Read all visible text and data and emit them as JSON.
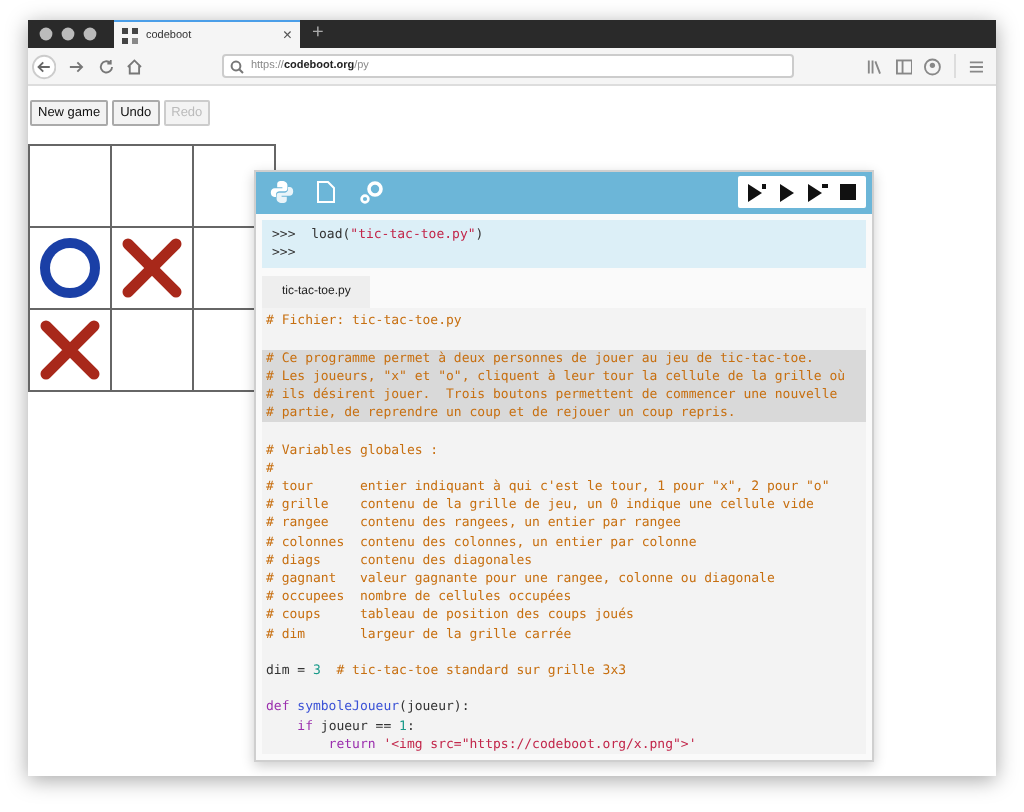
{
  "browser": {
    "tab_title": "codeboot",
    "tab_close": "×",
    "new_tab": "+",
    "url": "https://**codeboot.org**/py"
  },
  "page_buttons": [
    {
      "label": "New game",
      "disabled": false
    },
    {
      "label": "Undo",
      "disabled": false
    },
    {
      "label": "Redo",
      "disabled": true
    }
  ],
  "board": [
    [
      {
        "kind": "empty"
      },
      {
        "kind": "empty"
      },
      {
        "kind": "empty"
      }
    ],
    [
      {
        "kind": "o"
      },
      {
        "kind": "x"
      },
      {
        "kind": "empty"
      }
    ],
    [
      {
        "kind": "x"
      },
      {
        "kind": "empty"
      },
      {
        "kind": "empty"
      }
    ]
  ],
  "repl": [
    [
      {
        "kind": "prompt",
        "text": ">>>"
      },
      {
        "kind": "plain",
        "text": "  load("
      },
      {
        "kind": "string",
        "text": "\"tic-tac-toe.py\""
      },
      {
        "kind": "plain",
        "text": ")"
      }
    ],
    [
      {
        "kind": "prompt",
        "text": ">>>"
      }
    ]
  ],
  "editor_tab": {
    "label": "tic-tac-toe.py",
    "selected": true
  },
  "code": [
    {
      "kind": "code",
      "highlighted": false,
      "segments": [
        {
          "kind": "comment",
          "text": "# Fichier: tic-tac-toe.py"
        }
      ]
    },
    {
      "kind": "blank",
      "highlighted": false
    },
    {
      "kind": "code",
      "highlighted": true,
      "segments": [
        {
          "kind": "comment",
          "text": "# Ce programme permet à deux personnes de jouer au jeu de tic-tac-toe."
        }
      ]
    },
    {
      "kind": "code",
      "highlighted": true,
      "segments": [
        {
          "kind": "comment",
          "text": "# Les joueurs, \"x\" et \"o\", cliquent à leur tour la cellule de la grille où"
        }
      ]
    },
    {
      "kind": "code",
      "highlighted": true,
      "segments": [
        {
          "kind": "comment",
          "text": "# ils désirent jouer.  Trois boutons permettent de commencer une nouvelle"
        }
      ]
    },
    {
      "kind": "code",
      "highlighted": true,
      "segments": [
        {
          "kind": "comment",
          "text": "# partie, de reprendre un coup et de rejouer un coup repris."
        }
      ]
    },
    {
      "kind": "blank",
      "highlighted": false
    },
    {
      "kind": "code",
      "highlighted": false,
      "segments": [
        {
          "kind": "comment",
          "text": "# Variables globales :"
        }
      ]
    },
    {
      "kind": "code",
      "highlighted": false,
      "segments": [
        {
          "kind": "comment",
          "text": "#"
        }
      ]
    },
    {
      "kind": "code",
      "highlighted": false,
      "segments": [
        {
          "kind": "comment",
          "text": "# tour      entier indiquant à qui c'est le tour, 1 pour \"x\", 2 pour \"o\""
        }
      ]
    },
    {
      "kind": "code",
      "highlighted": false,
      "segments": [
        {
          "kind": "comment",
          "text": "# grille    contenu de la grille de jeu, un 0 indique une cellule vide"
        }
      ]
    },
    {
      "kind": "code",
      "highlighted": false,
      "segments": [
        {
          "kind": "comment",
          "text": "# rangee    contenu des rangees, un entier par rangee"
        }
      ]
    },
    {
      "kind": "code",
      "highlighted": false,
      "segments": [
        {
          "kind": "comment",
          "text": "# colonnes  contenu des colonnes, un entier par colonne"
        }
      ]
    },
    {
      "kind": "code",
      "highlighted": false,
      "segments": [
        {
          "kind": "comment",
          "text": "# diags     contenu des diagonales"
        }
      ]
    },
    {
      "kind": "code",
      "highlighted": false,
      "segments": [
        {
          "kind": "comment",
          "text": "# gagnant   valeur gagnante pour une rangee, colonne ou diagonale"
        }
      ]
    },
    {
      "kind": "code",
      "highlighted": false,
      "segments": [
        {
          "kind": "comment",
          "text": "# occupees  nombre de cellules occupées"
        }
      ]
    },
    {
      "kind": "code",
      "highlighted": false,
      "segments": [
        {
          "kind": "comment",
          "text": "# coups     tableau de position des coups joués"
        }
      ]
    },
    {
      "kind": "code",
      "highlighted": false,
      "segments": [
        {
          "kind": "comment",
          "text": "# dim       largeur de la grille carrée"
        }
      ]
    },
    {
      "kind": "blank",
      "highlighted": false
    },
    {
      "kind": "code",
      "highlighted": false,
      "segments": [
        {
          "kind": "plain",
          "text": "dim = "
        },
        {
          "kind": "number",
          "text": "3"
        },
        {
          "kind": "comment",
          "text": "  # tic-tac-toe standard sur grille 3x3"
        }
      ]
    },
    {
      "kind": "blank",
      "highlighted": false
    },
    {
      "kind": "code",
      "highlighted": false,
      "segments": [
        {
          "kind": "keyword",
          "text": "def "
        },
        {
          "kind": "function",
          "text": "symboleJoueur"
        },
        {
          "kind": "plain",
          "text": "(joueur):"
        }
      ]
    },
    {
      "kind": "code",
      "highlighted": false,
      "segments": [
        {
          "kind": "keyword",
          "text": "    if "
        },
        {
          "kind": "plain",
          "text": "joueur == "
        },
        {
          "kind": "number",
          "text": "1"
        },
        {
          "kind": "plain",
          "text": ":"
        }
      ]
    },
    {
      "kind": "code",
      "highlighted": false,
      "segments": [
        {
          "kind": "keyword",
          "text": "        return "
        },
        {
          "kind": "string",
          "text": "'<img src=\"https://codeboot.org/x.png\">'"
        }
      ]
    }
  ]
}
